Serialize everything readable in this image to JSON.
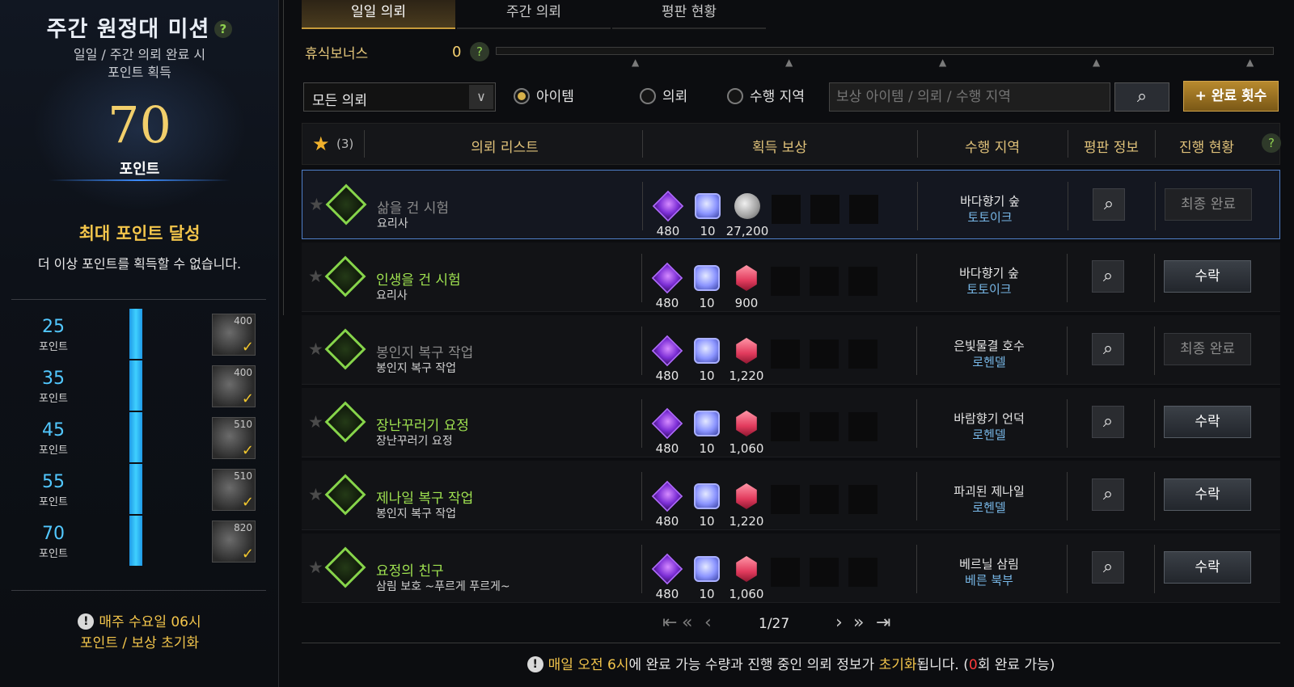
{
  "left": {
    "title": "주간 원정대 미션",
    "help": "?",
    "subtitle_line1": "일일 / 주간 의뢰 완료 시",
    "subtitle_line2": "포인트 획득",
    "points": "70",
    "points_label": "포인트",
    "max_title": "최대 포인트 달성",
    "max_sub": "더 이상 포인트를 획득할 수 없습니다.",
    "tiers": [
      {
        "points": "25",
        "unit": "포인트",
        "reward": "400",
        "claimed": true
      },
      {
        "points": "35",
        "unit": "포인트",
        "reward": "400",
        "claimed": true
      },
      {
        "points": "45",
        "unit": "포인트",
        "reward": "510",
        "claimed": true
      },
      {
        "points": "55",
        "unit": "포인트",
        "reward": "510",
        "claimed": true
      },
      {
        "points": "70",
        "unit": "포인트",
        "reward": "820",
        "claimed": true
      }
    ],
    "reset_line1": "매주 수요일 06시",
    "reset_line2": "포인트 / 보상 초기화"
  },
  "tabs": [
    "일일 의뢰",
    "주간 의뢰",
    "평판 현황"
  ],
  "bonus": {
    "label": "휴식보너스",
    "value": "0",
    "help": "?"
  },
  "filter": {
    "select": "모든 의뢰",
    "radio_items": "아이템",
    "radio_quest": "의뢰",
    "radio_region": "수행 지역",
    "search_placeholder": "보상 아이템 / 의뢰 / 수행 지역",
    "complete_btn": "+ 완료 횟수"
  },
  "header": {
    "count": "(3)",
    "quest_list": "의뢰 리스트",
    "rewards": "획득 보상",
    "region": "수행 지역",
    "rep": "평판 정보",
    "progress": "진행 현황",
    "help": "?"
  },
  "rows": [
    {
      "name": "삶을 건 시험",
      "sub": "요리사",
      "state": "done",
      "r1": "480",
      "r2": "10",
      "r3": "27,200",
      "r3type": "coin",
      "region": "바다향기 숲",
      "region_sub": "토토이크",
      "action": "최종 완료"
    },
    {
      "name": "인생을 건 시험",
      "sub": "요리사",
      "state": "avail",
      "r1": "480",
      "r2": "10",
      "r3": "900",
      "r3type": "red",
      "region": "바다향기 숲",
      "region_sub": "토토이크",
      "action": "수락"
    },
    {
      "name": "봉인지 복구 작업",
      "sub": "봉인지 복구 작업",
      "state": "done",
      "r1": "480",
      "r2": "10",
      "r3": "1,220",
      "r3type": "red",
      "region": "은빛물결 호수",
      "region_sub": "로헨델",
      "action": "최종 완료"
    },
    {
      "name": "장난꾸러기 요정",
      "sub": "장난꾸러기 요정",
      "state": "avail",
      "r1": "480",
      "r2": "10",
      "r3": "1,060",
      "r3type": "red",
      "region": "바람향기 언덕",
      "region_sub": "로헨델",
      "action": "수락"
    },
    {
      "name": "제나일 복구 작업",
      "sub": "봉인지 복구 작업",
      "state": "avail",
      "r1": "480",
      "r2": "10",
      "r3": "1,220",
      "r3type": "red",
      "region": "파괴된 제나일",
      "region_sub": "로헨델",
      "action": "수락"
    },
    {
      "name": "요정의 친구",
      "sub": "삼림 보호 ~푸르게 푸르게~",
      "state": "avail",
      "r1": "480",
      "r2": "10",
      "r3": "1,060",
      "r3type": "red",
      "region": "베르닐 삼림",
      "region_sub": "베른 북부",
      "action": "수락"
    }
  ],
  "pager": {
    "page": "1/27"
  },
  "footer": {
    "p1": "매일 오전 6시",
    "p2": "에 완료 가능 수량과 진행 중인 의뢰 정보가 ",
    "p3": "초기화",
    "p4": "됩니다. (",
    "p5": "0",
    "p6": "회 완료 가능)"
  },
  "colors": {
    "accent": "#c79b3b",
    "available": "#9fe250",
    "progress_bar": "#3fd0ff",
    "warning": "#f3c54b"
  }
}
